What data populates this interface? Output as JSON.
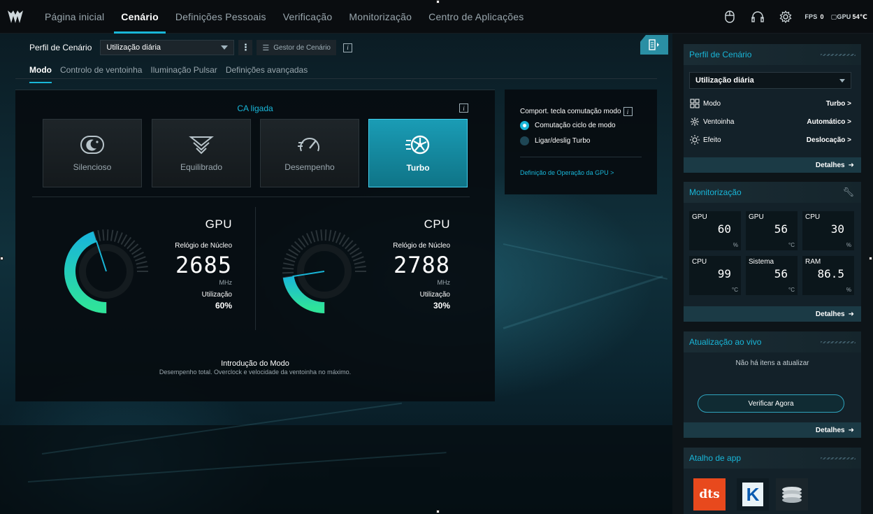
{
  "nav": {
    "items": [
      "Página inicial",
      "Cenário",
      "Definições Pessoais",
      "Verificação",
      "Monitorização",
      "Centro de Aplicações"
    ],
    "active_index": 1
  },
  "topbar": {
    "fps_label": "FPS",
    "fps_value": "0",
    "gpu_temp_label": "GPU",
    "gpu_temp_value": "54℃",
    "icons": [
      "mouse-icon",
      "headset-icon",
      "settings-gear-icon"
    ]
  },
  "profile": {
    "label": "Perfil de Cenário",
    "selected": "Utilização diária",
    "manager_label": "Gestor de Cenário",
    "info": "i"
  },
  "subtabs": [
    "Modo",
    "Controlo de ventoinha",
    "Iluminação Pulsar",
    "Definições avançadas"
  ],
  "main": {
    "ac_status": "CA ligada",
    "modes": [
      {
        "label": "Silencioso",
        "icon": "moon-icon",
        "active": false
      },
      {
        "label": "Equilibrado",
        "icon": "balance-chevron-icon",
        "active": false
      },
      {
        "label": "Desempenho",
        "icon": "speedometer-icon",
        "active": false
      },
      {
        "label": "Turbo",
        "icon": "turbo-fan-icon",
        "active": true
      }
    ],
    "gpu": {
      "title": "GPU",
      "clock_label": "Relógio de Núcleo",
      "clock_value": "2685",
      "unit": "MHz",
      "util_label": "Utilização",
      "util_value": "60%",
      "util_fraction": 0.6
    },
    "cpu": {
      "title": "CPU",
      "clock_label": "Relógio de Núcleo",
      "clock_value": "2788",
      "unit": "MHz",
      "util_label": "Utilização",
      "util_value": "30%",
      "util_fraction": 0.3
    },
    "intro_title": "Introdução do Modo",
    "intro_desc": "Desempenho total. Overclock e velocidade da ventoinha no máximo."
  },
  "switch_panel": {
    "title": "Comport. tecla comutação modo",
    "options": [
      {
        "label": "Comutação ciclo de modo",
        "checked": true
      },
      {
        "label": "Ligar/deslig Turbo",
        "checked": false
      }
    ],
    "gpu_link": "Definição de Operação da GPU >"
  },
  "sidebar": {
    "profile_card": {
      "title": "Perfil de Cenário",
      "selected": "Utilização diária",
      "rows": [
        {
          "label": "Modo",
          "value": "Turbo >",
          "icon": "grid-mode-icon"
        },
        {
          "label": "Ventoinha",
          "value": "Automático >",
          "icon": "fan-icon"
        },
        {
          "label": "Efeito",
          "value": "Deslocação >",
          "icon": "light-effect-icon"
        }
      ],
      "details": "Detalhes"
    },
    "monitor_card": {
      "title": "Monitorização",
      "tiles": [
        {
          "label": "GPU",
          "value": "60",
          "unit": "%"
        },
        {
          "label": "GPU",
          "value": "56",
          "unit": "°C"
        },
        {
          "label": "CPU",
          "value": "30",
          "unit": "%"
        },
        {
          "label": "CPU",
          "value": "99",
          "unit": "°C"
        },
        {
          "label": "Sistema",
          "value": "56",
          "unit": "°C"
        },
        {
          "label": "RAM",
          "value": "86.5",
          "unit": "%"
        }
      ],
      "details": "Detalhes"
    },
    "update_card": {
      "title": "Atualização ao vivo",
      "empty": "Não há itens a atualizar",
      "button": "Verificar Agora",
      "details": "Detalhes"
    },
    "apps_card": {
      "title": "Atalho de app",
      "apps": [
        {
          "name": "dts",
          "icon": "dts-app-icon"
        },
        {
          "name": "K",
          "icon": "killer-app-icon"
        },
        {
          "name": "",
          "icon": "disk-stack-app-icon"
        }
      ]
    }
  },
  "colors": {
    "accent": "#19b6d8",
    "gauge_green": "#2fe39a",
    "turbo_active": "#1a9cb5"
  }
}
